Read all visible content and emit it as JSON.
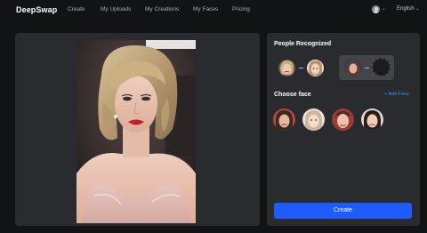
{
  "header": {
    "logo": "DeepSwap",
    "nav": [
      "Create",
      "My Uploads",
      "My Creations",
      "My Faces",
      "Pricing"
    ],
    "language": "English"
  },
  "right_panel": {
    "people_title": "People Recognized",
    "choose_title": "Choose face",
    "add_face_label": "+ Add Face",
    "create_label": "Create"
  },
  "colors": {
    "background": "#121314",
    "panel": "#2a2b2e",
    "accent": "#1f5cff",
    "link": "#3f8bff"
  },
  "icons": [
    "user-avatar-icon",
    "chevron-down-icon",
    "arrow-icon"
  ]
}
